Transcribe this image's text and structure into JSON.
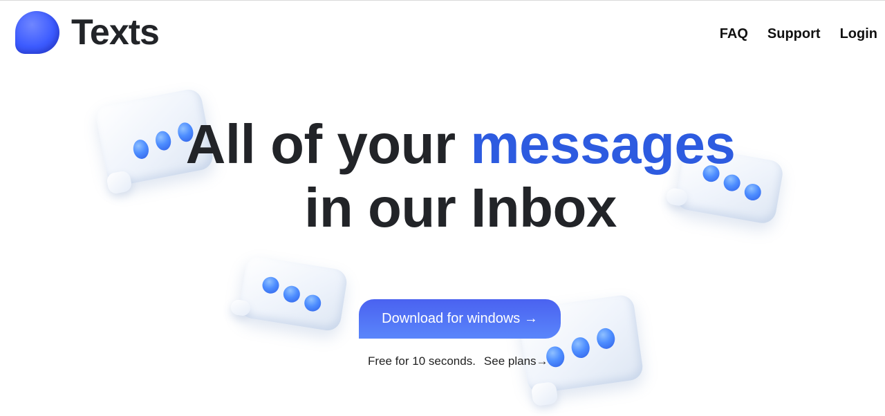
{
  "header": {
    "brand": "Texts",
    "nav": [
      {
        "label": "FAQ"
      },
      {
        "label": "Support"
      },
      {
        "label": "Login"
      }
    ]
  },
  "hero": {
    "line1_start": "All of your ",
    "line1_accent": "messages",
    "line2": "in our Inbox",
    "cta_label": "Download for windows →",
    "sub_text": "Free for 10 seconds.",
    "sub_link": "See plans→"
  },
  "icons": {
    "logo": "chat-bubble-logo-icon",
    "decor": "typing-bubble-icon"
  },
  "colors": {
    "accent": "#2d5be0",
    "button": "#4f6ef6",
    "text": "#222428"
  }
}
